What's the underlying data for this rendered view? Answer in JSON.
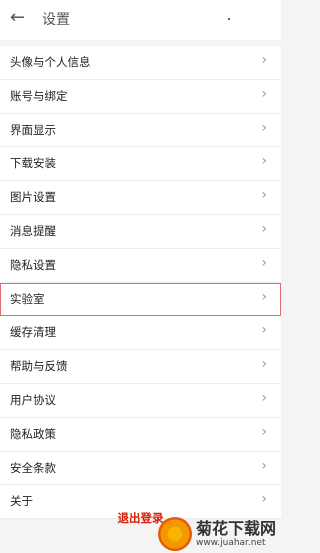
{
  "header": {
    "title": "设置"
  },
  "items": [
    {
      "label": "头像与个人信息"
    },
    {
      "label": "账号与绑定"
    },
    {
      "label": "界面显示"
    },
    {
      "label": "下载安装"
    },
    {
      "label": "图片设置"
    },
    {
      "label": "消息提醒"
    },
    {
      "label": "隐私设置"
    },
    {
      "label": "实验室"
    },
    {
      "label": "缓存清理"
    },
    {
      "label": "帮助与反馈"
    },
    {
      "label": "用户协议"
    },
    {
      "label": "隐私政策"
    },
    {
      "label": "安全条款"
    },
    {
      "label": "关于"
    }
  ],
  "logout_label": "退出登录",
  "watermark": {
    "name": "菊花下载网",
    "url": "www.juahar.net"
  },
  "colors": {
    "accent": "#d81e06",
    "highlight_border": "#e26b6b"
  }
}
